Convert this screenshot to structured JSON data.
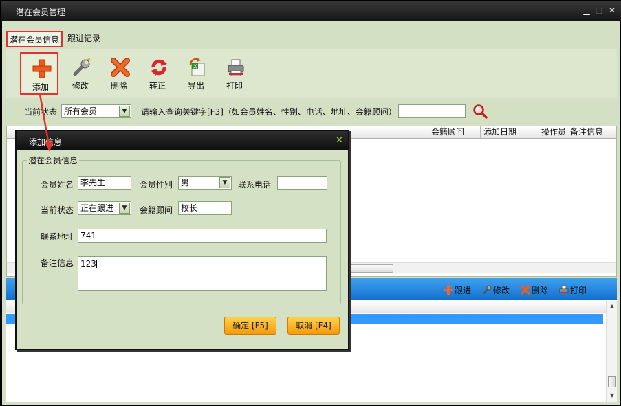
{
  "window": {
    "title": "潜在会员管理",
    "min": "▁",
    "max": "□",
    "close": "✕"
  },
  "tabs": [
    {
      "label": "潜在会员信息"
    },
    {
      "label": "跟进记录"
    }
  ],
  "toolbar": {
    "add": "添加",
    "edit": "修改",
    "delete": "删除",
    "transfer": "转正",
    "export": "导出",
    "print": "打印"
  },
  "filter": {
    "status_label": "当前状态",
    "status_value": "所有会员",
    "keyword_label": "请输入查询关键字[F3]（如会员姓名、性别、电话、地址、会籍顾问）",
    "keyword_value": ""
  },
  "grid": {
    "columns": [
      "会籍顾问",
      "添加日期",
      "操作员",
      "备注信息"
    ]
  },
  "followup_bar": {
    "follow": "跟进",
    "edit": "修改",
    "delete": "删除",
    "print": "打印"
  },
  "dialog": {
    "title": "添加信息",
    "close": "✕",
    "group": "潜在会员信息",
    "name_label": "会员姓名",
    "name_value": "李先生",
    "gender_label": "会员性别",
    "gender_value": "男",
    "phone_label": "联系电话",
    "phone_value": "",
    "status_label": "当前状态",
    "status_value": "正在跟进",
    "advisor_label": "会籍顾问",
    "advisor_value": "校长",
    "address_label": "联系地址",
    "address_value": "741",
    "remark_label": "备注信息",
    "remark_value": "123",
    "ok": "确定 [F5]",
    "cancel": "取消 [F4]"
  },
  "colors": {
    "accent_red": "#e53030",
    "bar_blue": "#1f86e0",
    "button_orange": "#f7a81b",
    "panel_green": "#d4e0c4"
  }
}
